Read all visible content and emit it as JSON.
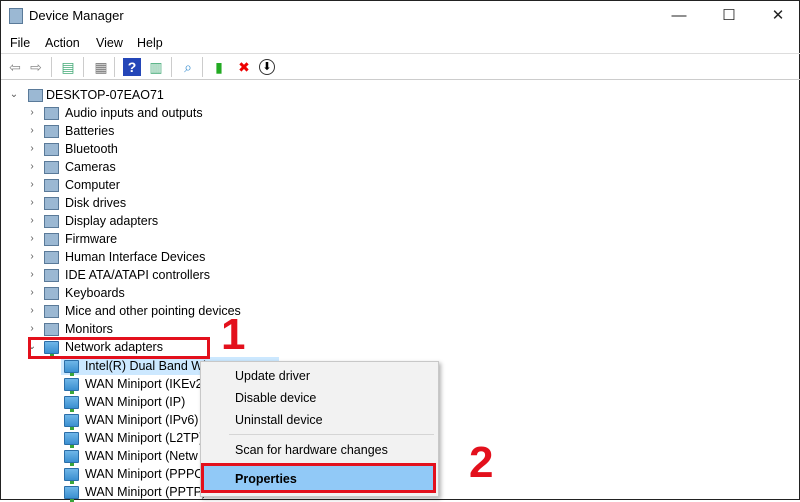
{
  "window": {
    "title": "Device Manager",
    "minimize": "—",
    "maximize": "☐",
    "close": "✕"
  },
  "menubar": [
    "File",
    "Action",
    "View",
    "Help"
  ],
  "toolbar": [
    {
      "icon": "back-arrow-icon",
      "glyph": "⇦",
      "color": "#888"
    },
    {
      "icon": "forward-arrow-icon",
      "glyph": "⇨",
      "color": "#888"
    },
    {
      "icon": "show-hide-console-tree-icon",
      "glyph": "▤",
      "color": "#4a7"
    },
    {
      "icon": "properties-icon",
      "glyph": "▦",
      "color": "#777"
    },
    {
      "icon": "help-icon",
      "glyph": "?",
      "color": "#fff"
    },
    {
      "icon": "action-pane-icon",
      "glyph": "▥",
      "color": "#4a7"
    },
    {
      "icon": "scan-hardware-icon",
      "glyph": "⌕",
      "color": "#3a8fd0"
    },
    {
      "icon": "update-driver-icon",
      "glyph": "▮",
      "color": "#2a2"
    },
    {
      "icon": "uninstall-icon",
      "glyph": "✖",
      "color": "#e00"
    },
    {
      "icon": "disable-device-icon",
      "glyph": "⬇",
      "color": "#000"
    }
  ],
  "tree": {
    "root": "DESKTOP-07EAO71",
    "categories": [
      "Audio inputs and outputs",
      "Batteries",
      "Bluetooth",
      "Cameras",
      "Computer",
      "Disk drives",
      "Display adapters",
      "Firmware",
      "Human Interface Devices",
      "IDE ATA/ATAPI controllers",
      "Keyboards",
      "Mice and other pointing devices",
      "Monitors",
      "Network adapters"
    ],
    "network_children": [
      "Intel(R) Dual Band Wi",
      "WAN Miniport (IKEv2",
      "WAN Miniport (IP)",
      "WAN Miniport (IPv6)",
      "WAN Miniport (L2TP)",
      "WAN Miniport (Netw",
      "WAN Miniport (PPPO",
      "WAN Miniport (PPTP)"
    ]
  },
  "context_menu": {
    "update": "Update driver",
    "disable": "Disable device",
    "uninstall": "Uninstall device",
    "scan": "Scan for hardware changes",
    "properties": "Properties"
  },
  "annotations": {
    "step1": "1",
    "step2": "2",
    "color": "#e3101c"
  }
}
